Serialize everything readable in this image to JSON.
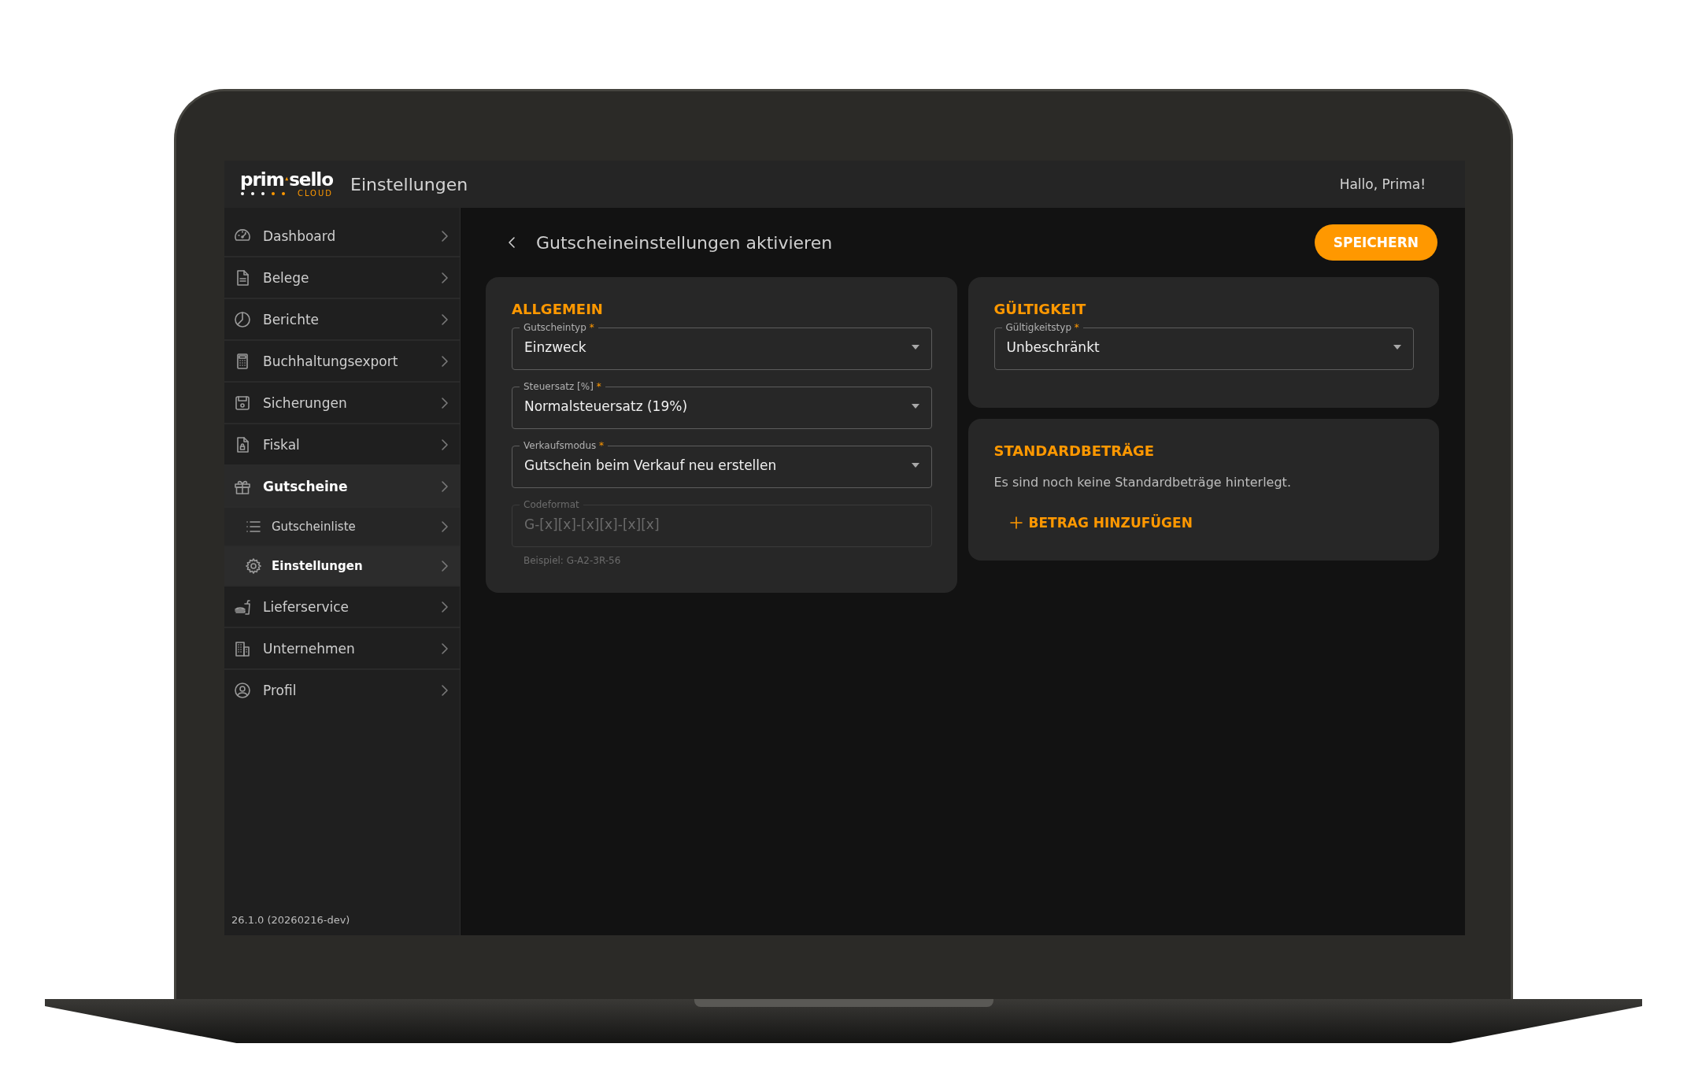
{
  "logo": {
    "left": "prim",
    "right": "sello",
    "sub": "CLOUD"
  },
  "header": {
    "title": "Einstellungen",
    "greeting": "Hallo, Prima!"
  },
  "sidebar": {
    "items": [
      {
        "label": "Dashboard",
        "selected": false
      },
      {
        "label": "Belege",
        "selected": false
      },
      {
        "label": "Berichte",
        "selected": false
      },
      {
        "label": "Buchhaltungsexport",
        "selected": false
      },
      {
        "label": "Sicherungen",
        "selected": false
      },
      {
        "label": "Fiskal",
        "selected": false
      },
      {
        "label": "Gutscheine",
        "selected": true,
        "children": [
          {
            "label": "Gutscheinliste",
            "selected": false
          },
          {
            "label": "Einstellungen",
            "selected": true
          }
        ]
      },
      {
        "label": "Lieferservice",
        "selected": false
      },
      {
        "label": "Unternehmen",
        "selected": false
      },
      {
        "label": "Profil",
        "selected": false
      }
    ],
    "version": "26.1.0 (20260216-dev)"
  },
  "page": {
    "title": "Gutscheineinstellungen aktivieren",
    "save_button": "SPEICHERN"
  },
  "columns": [
    {
      "cards": [
        {
          "title": "ALLGEMEIN",
          "fields": [
            {
              "kind": "select",
              "label": "Gutscheintyp",
              "required_mark": "*",
              "value": "Einzweck",
              "disabled": false
            },
            {
              "kind": "select",
              "label": "Steuersatz [%]",
              "required_mark": "*",
              "value": "Normalsteuersatz (19%)",
              "disabled": false
            },
            {
              "kind": "select",
              "label": "Verkaufsmodus",
              "required_mark": "*",
              "value": "Gutschein beim Verkauf neu erstellen",
              "disabled": false
            },
            {
              "kind": "text",
              "label": "Codeformat",
              "value": "G-[x][x]-[x][x]-[x][x]",
              "disabled": true,
              "hint": "Beispiel: G-A2-3R-56"
            }
          ]
        }
      ]
    },
    {
      "cards": [
        {
          "title": "GÜLTIGKEIT",
          "fields": [
            {
              "kind": "select",
              "label": "Gültigkeitstyp",
              "required_mark": "*",
              "value": "Unbeschränkt",
              "disabled": false
            }
          ]
        },
        {
          "title": "STANDARDBETRÄGE",
          "message": "Es sind noch keine Standardbeträge hinterlegt.",
          "action": "BETRAG HINZUFÜGEN"
        }
      ]
    }
  ]
}
